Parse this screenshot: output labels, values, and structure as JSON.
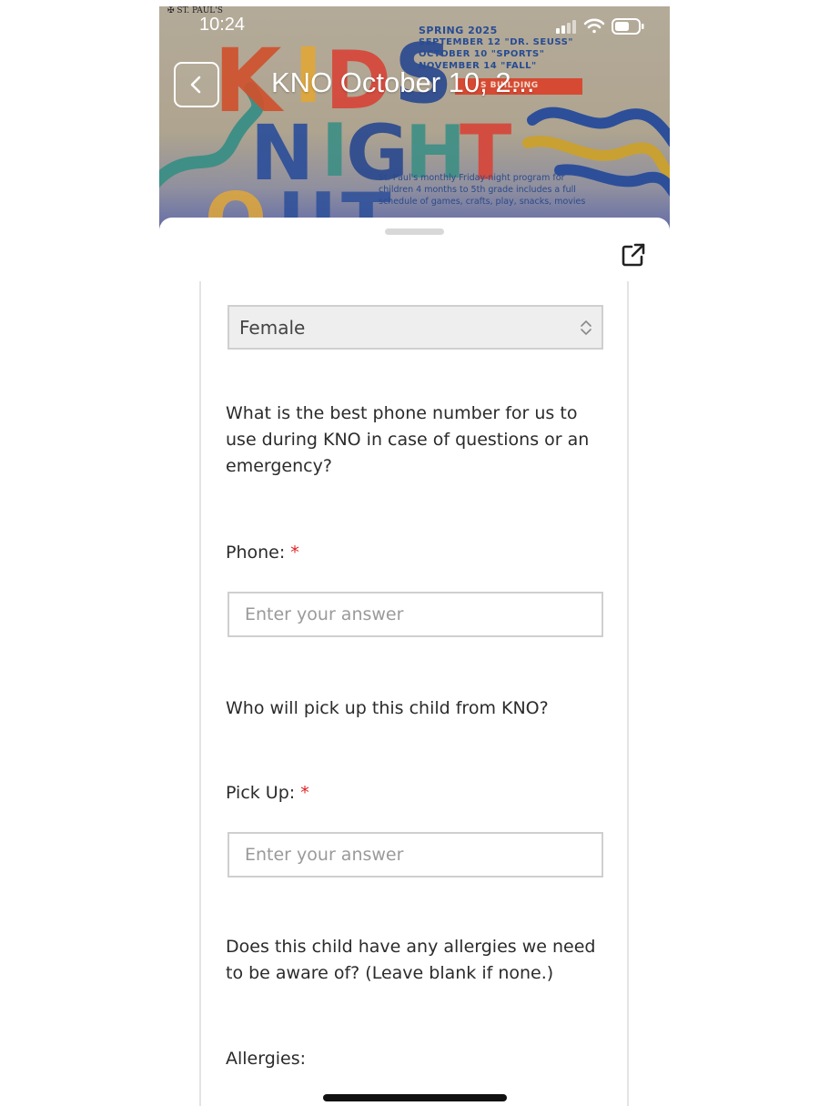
{
  "status_bar": {
    "time": "10:24"
  },
  "banner": {
    "org_name": "ST. PAUL'S",
    "season_line": "SPRING 2025",
    "dates": [
      "SEPTEMBER 12 \"DR. SEUSS\"",
      "OCTOBER 10 \"SPORTS\"",
      "NOVEMBER 14 \"FALL\""
    ],
    "building_text": "S BUILDING",
    "description": "St. Paul's monthly Friday-night program for children 4 months to 5th grade includes a full schedule of games, crafts, play, snacks, movies"
  },
  "header": {
    "title": "KNO October 10, 2..."
  },
  "colors": {
    "required": "#e02020",
    "title": "#ffffff",
    "border": "#cfcfcf"
  },
  "icons": {
    "back": "chevron-left-icon",
    "open_external": "external-link-icon"
  },
  "form": {
    "gender": {
      "value": "Female"
    },
    "phone_question": "What is the best phone number for us to use during KNO in case of questions or an emergency?",
    "phone": {
      "label": "Phone:",
      "required_mark": "*",
      "placeholder": "Enter your answer"
    },
    "pickup_question": "Who will pick up this child from KNO?",
    "pickup": {
      "label": "Pick Up:",
      "required_mark": "*",
      "placeholder": "Enter your answer"
    },
    "allergies_question": "Does this child have any allergies we need to be aware of? (Leave blank if none.)",
    "allergies": {
      "label": "Allergies:"
    }
  }
}
